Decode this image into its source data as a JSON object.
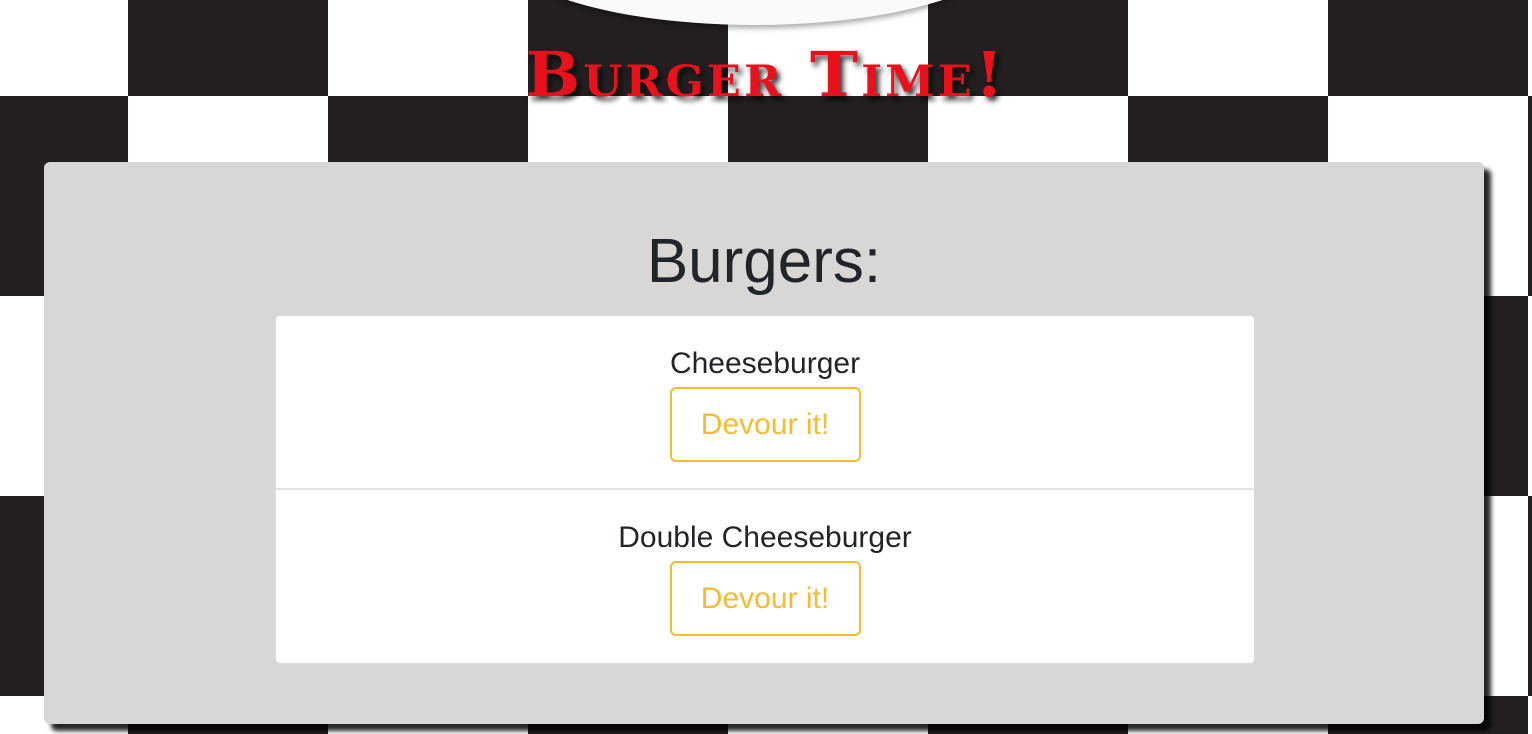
{
  "site": {
    "title": "Burger Time!"
  },
  "panel": {
    "heading": "Burgers:"
  },
  "burgers": [
    {
      "name": "Cheeseburger",
      "action_label": "Devour it!"
    },
    {
      "name": "Double Cheeseburger",
      "action_label": "Devour it!"
    }
  ],
  "colors": {
    "title_red": "#e8111c",
    "button_accent": "#f5bc2f",
    "panel_gray": "#d8d7d5",
    "checker_dark": "#231f20"
  }
}
